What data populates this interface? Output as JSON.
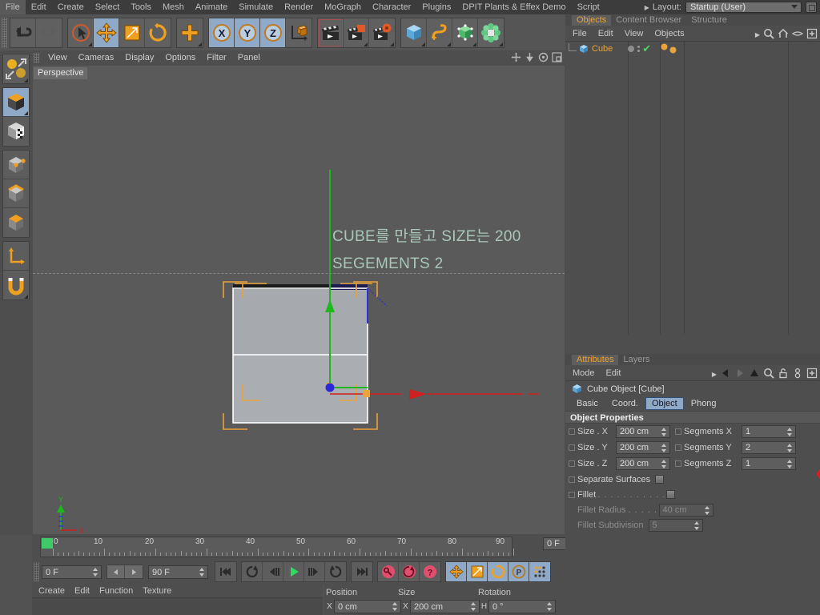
{
  "menubar": {
    "items": [
      "File",
      "Edit",
      "Create",
      "Select",
      "Tools",
      "Mesh",
      "Animate",
      "Simulate",
      "Render",
      "MoGraph",
      "Character",
      "Plugins",
      "DPIT Plants & Effex Demo",
      "Script"
    ],
    "layout_label": "Layout:",
    "layout_value": "Startup (User)"
  },
  "toolbar": {
    "groups": [
      {
        "name": "undo-redo",
        "buttons": [
          {
            "icon": "undo-icon",
            "selected": false
          },
          {
            "icon": "redo-icon",
            "selected": false
          }
        ]
      },
      {
        "name": "transform",
        "buttons": [
          {
            "icon": "select-live-icon",
            "selected": false
          },
          {
            "icon": "move-icon",
            "selected": true
          },
          {
            "icon": "scale-icon",
            "selected": false
          },
          {
            "icon": "rotate-icon",
            "selected": false
          }
        ]
      },
      {
        "name": "world-object",
        "buttons": [
          {
            "icon": "add-icon",
            "selected": false
          }
        ]
      },
      {
        "name": "axis-lock",
        "buttons": [
          {
            "icon": "axis-x-icon",
            "selected": true
          },
          {
            "icon": "axis-y-icon",
            "selected": true
          },
          {
            "icon": "axis-z-icon",
            "selected": true
          },
          {
            "icon": "world-coord-icon",
            "selected": false
          }
        ]
      },
      {
        "name": "render",
        "buttons": [
          {
            "icon": "render-view-icon",
            "selected": false
          },
          {
            "icon": "render-picture-viewer-icon",
            "selected": false
          },
          {
            "icon": "render-settings-icon",
            "selected": false
          }
        ]
      },
      {
        "name": "primitives",
        "buttons": [
          {
            "icon": "cube-primitive-icon",
            "selected": false
          },
          {
            "icon": "spline-icon",
            "selected": false
          },
          {
            "icon": "generator-icon",
            "selected": false
          },
          {
            "icon": "deformer-icon",
            "selected": false
          }
        ]
      }
    ]
  },
  "left_palette": {
    "groups": [
      {
        "name": "live-selection",
        "buttons": [
          {
            "icon": "live-selection-icon",
            "selected": false
          }
        ]
      },
      {
        "name": "modes",
        "buttons": [
          {
            "icon": "model-mode-icon",
            "selected": true
          },
          {
            "icon": "texture-mode-icon",
            "selected": false
          }
        ]
      },
      {
        "name": "components",
        "buttons": [
          {
            "icon": "points-mode-icon",
            "selected": false
          },
          {
            "icon": "edges-mode-icon",
            "selected": false
          },
          {
            "icon": "polygons-mode-icon",
            "selected": false
          }
        ]
      },
      {
        "name": "axis-snap",
        "buttons": [
          {
            "icon": "enable-axis-icon",
            "selected": false
          },
          {
            "icon": "snap-magnet-icon",
            "selected": false
          }
        ]
      }
    ]
  },
  "viewport": {
    "menu": [
      "View",
      "Cameras",
      "Display",
      "Options",
      "Filter",
      "Panel"
    ],
    "view_label": "Perspective",
    "annotation_line1": "CUBE를 만들고 SIZE는 200",
    "annotation_line2": "SEGEMENTS 2",
    "annotation_color": "#a9c7b8",
    "axis_gizmo": {
      "y_label": "Y",
      "x_label": "X"
    }
  },
  "timeline": {
    "tick_labels": [
      "0",
      "10",
      "20",
      "30",
      "40",
      "50",
      "60",
      "70",
      "80",
      "90"
    ],
    "current_frame": "0 F"
  },
  "transport": {
    "start_frame": "0 F",
    "end_frame": "90 F",
    "buttons": [
      {
        "name": "go-to-start-button",
        "icon": "skip-start-icon"
      },
      {
        "name": "loop-button",
        "icon": "loop-icon"
      },
      {
        "name": "previous-key-button",
        "icon": "prev-key-icon"
      },
      {
        "name": "play-button",
        "icon": "play-icon"
      },
      {
        "name": "next-key-button",
        "icon": "next-key-icon"
      },
      {
        "name": "play-forward-button",
        "icon": "step-forward-icon"
      },
      {
        "name": "go-to-end-button",
        "icon": "skip-end-icon"
      },
      {
        "name": "record-keyframe-button",
        "icon": "record-key-icon"
      },
      {
        "name": "autokeying-button",
        "icon": "autokey-icon"
      },
      {
        "name": "keyframe-selection-button",
        "icon": "key-question-icon"
      },
      {
        "name": "position-key-button",
        "icon": "position-key-icon"
      },
      {
        "name": "scale-key-button",
        "icon": "scale-key-icon"
      },
      {
        "name": "rotation-key-button",
        "icon": "rotation-key-icon"
      },
      {
        "name": "param-key-button",
        "icon": "param-key-icon"
      },
      {
        "name": "pla-key-button",
        "icon": "pla-key-icon"
      }
    ]
  },
  "material_manager": {
    "menu": [
      "Create",
      "Edit",
      "Function",
      "Texture"
    ]
  },
  "coordinates": {
    "headers": [
      "Position",
      "Size",
      "Rotation"
    ],
    "rows": [
      {
        "axis_left": "X",
        "value_left": "0 cm",
        "axis_mid": "X",
        "value_mid": "200 cm",
        "axis_right": "H",
        "value_right": "0 °"
      }
    ]
  },
  "object_manager": {
    "tabs": [
      {
        "label": "Objects",
        "active": true
      },
      {
        "label": "Content Browser",
        "active": false
      },
      {
        "label": "Structure",
        "active": false
      }
    ],
    "menu": [
      "File",
      "Edit",
      "View",
      "Objects"
    ],
    "objects": [
      {
        "name": "Cube",
        "icon": "cube-object-icon",
        "visible_dot": "•",
        "enabled_check": "✔"
      }
    ]
  },
  "attributes": {
    "tabs": [
      {
        "label": "Attributes",
        "active": true
      },
      {
        "label": "Layers",
        "active": false
      }
    ],
    "menu": [
      "Mode",
      "Edit"
    ],
    "object_title": "Cube Object [Cube]",
    "subtabs": [
      {
        "label": "Basic",
        "active": false
      },
      {
        "label": "Coord.",
        "active": false
      },
      {
        "label": "Object",
        "active": true
      },
      {
        "label": "Phong",
        "active": false
      }
    ],
    "section_title": "Object Properties",
    "properties": [
      {
        "label": "Size . X",
        "value": "200 cm",
        "label2": "Segments X",
        "value2": "1",
        "dim": false
      },
      {
        "label": "Size . Y",
        "value": "200 cm",
        "label2": "Segments Y",
        "value2": "2",
        "dim": false
      },
      {
        "label": "Size . Z",
        "value": "200 cm",
        "label2": "Segments Z",
        "value2": "1",
        "dim": false
      }
    ],
    "toggles": [
      {
        "label": "Separate Surfaces",
        "dim": false
      },
      {
        "label": "Fillet",
        "dim": false
      }
    ],
    "dim_fields": [
      {
        "label": "Fillet Radius",
        "value": "40 cm"
      },
      {
        "label": "Fillet Subdivision",
        "value": "5"
      }
    ],
    "highlight_color": "#e01b1b"
  }
}
